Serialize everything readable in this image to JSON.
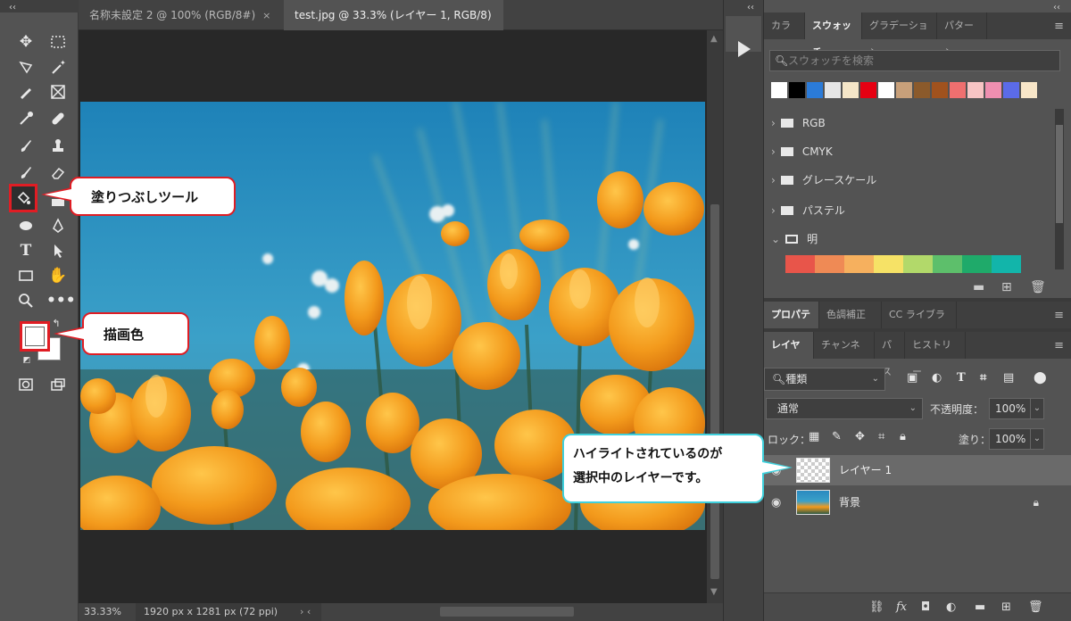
{
  "toolbar": {
    "collapse_glyph": "‹‹",
    "callout_fill": "塗りつぶしツール",
    "callout_fg": "描画色"
  },
  "document": {
    "tabs": [
      {
        "label": "名称未設定 2 @ 100% (RGB/8#)",
        "close": "×"
      },
      {
        "label": "test.jpg @ 33.3% (レイヤー 1, RGB/8) *",
        "close": "×"
      }
    ],
    "status": {
      "zoom": "33.33%",
      "info": "1920 px x 1281 px (72 ppi)",
      "nav": "›  ‹"
    }
  },
  "midstrip": {
    "collapse_glyph": "‹‹"
  },
  "right_collapse": "‹‹",
  "swatches_panel": {
    "tabs": [
      "カラー",
      "スウォッチ",
      "グラデーション",
      "パターン"
    ],
    "search_placeholder": "スウォッチを検索",
    "swatch_colors": [
      "#ffffff",
      "#000000",
      "#2b7bd8",
      "#e6e6e6",
      "#f5e6c8",
      "#e60012",
      "#ffffff",
      "#c8a07a",
      "#8b5a2b",
      "#a0521e",
      "#ef6f6f",
      "#f7c4c4",
      "#ef8fb0",
      "#5b6be8",
      "#f8e6c8"
    ],
    "folders": [
      {
        "chev": "›",
        "name": "RGB",
        "open": false
      },
      {
        "chev": "›",
        "name": "CMYK",
        "open": false
      },
      {
        "chev": "›",
        "name": "グレースケール",
        "open": false
      },
      {
        "chev": "›",
        "name": "パステル",
        "open": false
      },
      {
        "chev": "⌄",
        "name": "明",
        "open": true
      }
    ],
    "bright_colors": [
      "#e8554a",
      "#ef8a55",
      "#f6b05e",
      "#f6e266",
      "#b2d96a",
      "#5dbf6b",
      "#1faa6a",
      "#12b5aa"
    ]
  },
  "props_panel": {
    "tabs": [
      "プロパティ",
      "色調補正",
      "CC ライブラリ"
    ]
  },
  "layers_panel": {
    "tabs": [
      "レイヤー",
      "チャンネル",
      "パス",
      "ヒストリー"
    ],
    "filter_label": "種類",
    "blend_mode": "通常",
    "opacity_label": "不透明度：",
    "opacity_value": "100%",
    "lock_label": "ロック：",
    "fill_label": "塗り：",
    "fill_value": "100%",
    "layers": [
      {
        "name": "レイヤー 1",
        "selected": true
      },
      {
        "name": "背景",
        "selected": false
      }
    ],
    "callout_selected": "ハイライトされているのが\n選択中のレイヤーです。"
  }
}
